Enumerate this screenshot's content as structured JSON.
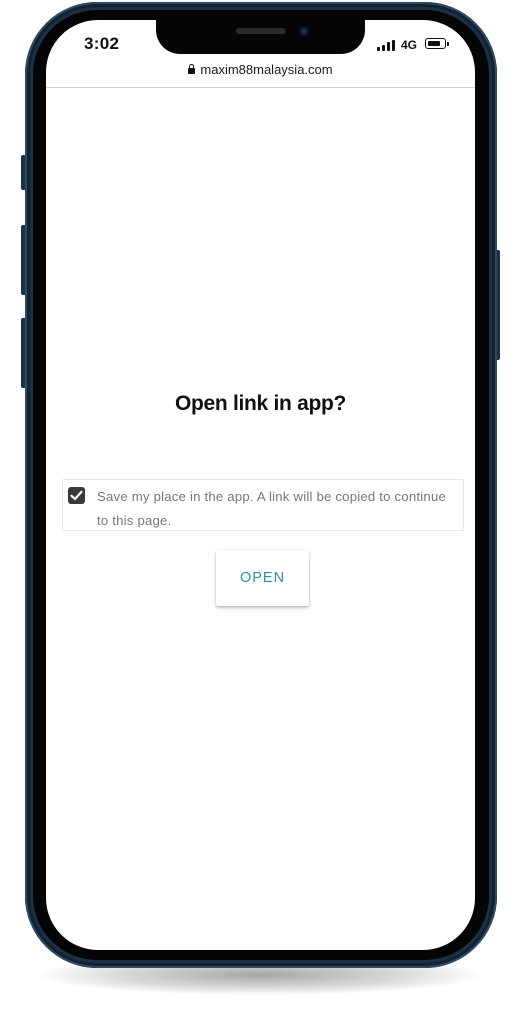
{
  "status_bar": {
    "time": "3:02",
    "network": "4G",
    "icons": [
      "signal-bars-icon",
      "battery-icon"
    ]
  },
  "browser": {
    "url": "maxim88malaysia.com",
    "url_icon": "lock-icon"
  },
  "dialog": {
    "title": "Open link in app?",
    "checkbox_checked": true,
    "checkbox_label": "Save my place in the app. A link will be copied to continue to this page.",
    "open_button_label": "OPEN",
    "accent_color": "#2f8fa3"
  }
}
